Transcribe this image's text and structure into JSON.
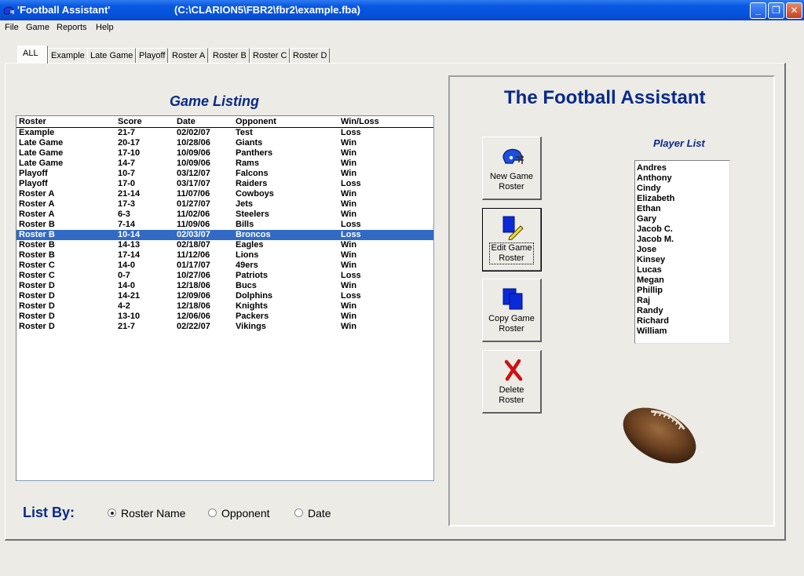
{
  "window": {
    "title": "'Football Assistant'",
    "path": "(C:\\CLARION5\\FBR2\\fbr2\\example.fba)",
    "minimize": "_",
    "maximize": "❐",
    "close": "✕"
  },
  "menu": [
    "File",
    "Game",
    "Reports",
    "Help"
  ],
  "tabs": [
    "ALL",
    "Example",
    "Late Game",
    "Playoff",
    "Roster A",
    "Roster B",
    "Roster C",
    "Roster D"
  ],
  "game_listing": {
    "title": "Game Listing",
    "columns": [
      "Roster",
      "Score",
      "Date",
      "Opponent",
      "Win/Loss"
    ],
    "rows": [
      [
        "Example",
        "21-7",
        "02/02/07",
        "Test",
        "Loss"
      ],
      [
        "Late Game",
        "20-17",
        "10/28/06",
        "Giants",
        "Win"
      ],
      [
        "Late Game",
        "17-10",
        "10/09/06",
        "Panthers",
        "Win"
      ],
      [
        "Late Game",
        "14-7",
        "10/09/06",
        "Rams",
        "Win"
      ],
      [
        "Playoff",
        "10-7",
        "03/12/07",
        "Falcons",
        "Win"
      ],
      [
        "Playoff",
        "17-0",
        "03/17/07",
        "Raiders",
        "Loss"
      ],
      [
        "Roster A",
        "21-14",
        "11/07/06",
        "Cowboys",
        "Win"
      ],
      [
        "Roster A",
        "17-3",
        "01/27/07",
        "Jets",
        "Win"
      ],
      [
        "Roster A",
        "6-3",
        "11/02/06",
        "Steelers",
        "Win"
      ],
      [
        "Roster B",
        "7-14",
        "11/09/06",
        "Bills",
        "Loss"
      ],
      [
        "Roster B",
        "10-14",
        "02/03/07",
        "Broncos",
        "Loss"
      ],
      [
        "Roster B",
        "14-13",
        "02/18/07",
        "Eagles",
        "Win"
      ],
      [
        "Roster B",
        "17-14",
        "11/12/06",
        "Lions",
        "Win"
      ],
      [
        "Roster C",
        "14-0",
        "01/17/07",
        "49ers",
        "Win"
      ],
      [
        "Roster C",
        "0-7",
        "10/27/06",
        "Patriots",
        "Loss"
      ],
      [
        "Roster D",
        "14-0",
        "12/18/06",
        "Bucs",
        "Win"
      ],
      [
        "Roster D",
        "14-21",
        "12/09/06",
        "Dolphins",
        "Loss"
      ],
      [
        "Roster D",
        "4-2",
        "12/18/06",
        "Knights",
        "Win"
      ],
      [
        "Roster D",
        "13-10",
        "12/06/06",
        "Packers",
        "Win"
      ],
      [
        "Roster D",
        "21-7",
        "02/22/07",
        "Vikings",
        "Win"
      ]
    ],
    "selected_row": 10
  },
  "list_by": {
    "label": "List By:",
    "options": [
      "Roster Name",
      "Opponent",
      "Date"
    ],
    "selected": 0
  },
  "assistant": {
    "title": "The Football Assistant",
    "buttons": [
      {
        "line1": "New Game",
        "line2": "Roster",
        "icon": "helmet-icon"
      },
      {
        "line1": "Edit Game",
        "line2": "Roster",
        "icon": "edit-pencil-icon"
      },
      {
        "line1": "Copy Game",
        "line2": "Roster",
        "icon": "copy-pages-icon"
      },
      {
        "line1": "Delete",
        "line2": "Roster",
        "icon": "red-x-icon"
      }
    ],
    "player_list_title": "Player List",
    "players": [
      "Andres",
      "Anthony",
      "Cindy",
      "Elizabeth",
      "Ethan",
      "Gary",
      "Jacob C.",
      "Jacob M.",
      "Jose",
      "Kinsey",
      "Lucas",
      "Megan",
      "Phillip",
      "Raj",
      "Randy",
      "Richard",
      "William"
    ]
  },
  "colors": {
    "titlebar": "#0553dc",
    "heading": "#0a2a8a",
    "selection": "#316ac5"
  }
}
